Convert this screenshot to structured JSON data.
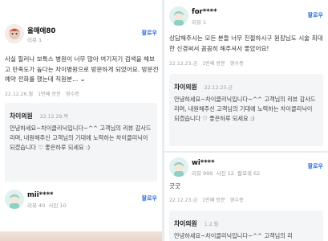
{
  "left": {
    "review1": {
      "user": "올매에80",
      "meta": "리뷰 1",
      "follow": "팔로우",
      "text": "사실 필러나 보톡스 병원이 너무 많아 여기저기 검색을 해보고 만족도가 높다는 차이병원으로 방문하게 되었어요. 방문전 예약 전화를 했는데 직원분...",
      "more": "⌄",
      "date": "22.12.26.월",
      "visit": "1번째 방문",
      "receipt": "영수증",
      "reply": {
        "name": "차이의원",
        "date": "22.12.29.목",
        "body": "안녕하세요~차이클리닉입니다~^^ 고객님의 리뷰 감사드리며, 내원해주신 고객님의 기대에 노력하는 차이클리닉이 되겠습니다 ♡ 좋은하루 되세요 :)"
      }
    },
    "review2": {
      "user": "mii****",
      "meta_reviews": "리뷰 40",
      "meta_photos": "사진 10",
      "follow": "팔로우"
    }
  },
  "right": {
    "review1": {
      "user": "for****",
      "meta": "리뷰 1",
      "follow": "팔로우",
      "text": "상담해주시는 모든 분들 너무 친절하시구 원장님도 시술 최대한 신경써서 꼼꼼히 해주셔서 좋았어요!",
      "date": "22.12.23.금",
      "visit": "1번째 방문",
      "receipt": "영수증",
      "reply": {
        "name": "차이의원",
        "date": "22.12.23.금",
        "body": "안녕하세요~차이클리닉입니다~^^ 고객님의 리뷰 감사드리며, 내원해주신 고객님의 기대에 노력하는 차이클리닉이 되겠습니다 ♡ 좋은하루 되세요 :)"
      }
    },
    "review2": {
      "user": "wi****",
      "meta_reviews": "리뷰 999",
      "meta_photos": "사진 12",
      "meta_followers": "팔로워 62",
      "follow": "팔로우",
      "text": "굿굿",
      "date": "22.12.23.금",
      "visit": "1번째 방문",
      "receipt": "영수증",
      "reply": {
        "name": "차이의원",
        "date": "1.2.월",
        "body": "안녕하세요~차이클리닉입니다~^^ 고객님의 리"
      }
    }
  },
  "colors": {
    "follow": "#2f6fe4",
    "background": "#e9ecef",
    "reply_bg": "#f4f5f7"
  }
}
